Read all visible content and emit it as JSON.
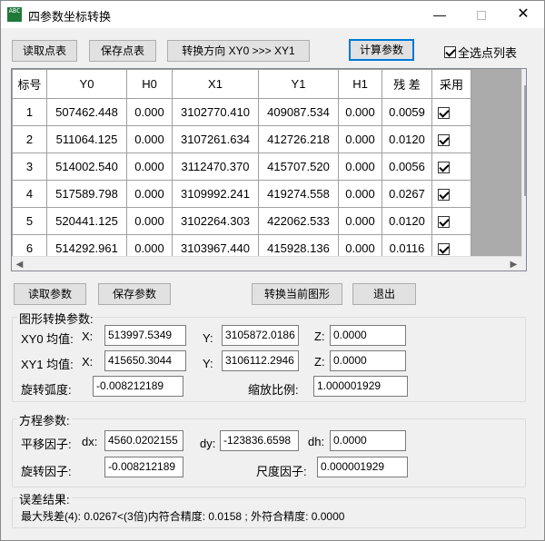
{
  "window": {
    "title": "四参数坐标转换",
    "icon_glyph": "ABC",
    "minimize": "—",
    "close": "✕"
  },
  "toolbar": {
    "read_points": "读取点表",
    "save_points": "保存点表",
    "direction": "转换方向 XY0 >>> XY1",
    "calc_params": "计算参数",
    "select_all_label": "全选点列表",
    "select_all_checked": true
  },
  "table": {
    "headers": [
      "标号",
      "Y0",
      "H0",
      "X1",
      "Y1",
      "H1",
      "残 差",
      "采用"
    ],
    "rows": [
      {
        "id": "1",
        "y0": "507462.448",
        "h0": "0.000",
        "x1": "3102770.410",
        "y1": "409087.534",
        "h1": "0.000",
        "res": "0.0059",
        "used": true
      },
      {
        "id": "2",
        "y0": "511064.125",
        "h0": "0.000",
        "x1": "3107261.634",
        "y1": "412726.218",
        "h1": "0.000",
        "res": "0.0120",
        "used": true
      },
      {
        "id": "3",
        "y0": "514002.540",
        "h0": "0.000",
        "x1": "3112470.370",
        "y1": "415707.520",
        "h1": "0.000",
        "res": "0.0056",
        "used": true
      },
      {
        "id": "4",
        "y0": "517589.798",
        "h0": "0.000",
        "x1": "3109992.241",
        "y1": "419274.558",
        "h1": "0.000",
        "res": "0.0267",
        "used": true
      },
      {
        "id": "5",
        "y0": "520441.125",
        "h0": "0.000",
        "x1": "3102264.303",
        "y1": "422062.533",
        "h1": "0.000",
        "res": "0.0120",
        "used": true
      },
      {
        "id": "6",
        "y0": "514292.961",
        "h0": "0.000",
        "x1": "3103967.440",
        "y1": "415928.136",
        "h1": "0.000",
        "res": "0.0116",
        "used": true
      }
    ]
  },
  "actions": {
    "read_params": "读取参数",
    "save_params": "保存参数",
    "convert_shape": "转换当前图形",
    "exit": "退出"
  },
  "transform_params": {
    "group_title": "图形转换参数:",
    "xy0_label": "XY0 均值:",
    "xy1_label": "XY1 均值:",
    "x_label": "X:",
    "y_label": "Y:",
    "z_label": "Z:",
    "xy0_x": "513997.5349",
    "xy0_y": "3105872.0186",
    "xy0_z": "0.0000",
    "xy1_x": "415650.3044",
    "xy1_y": "3106112.2946",
    "xy1_z": "0.0000",
    "rotation_label": "旋转弧度:",
    "rotation": "-0.008212189",
    "scale_label": "缩放比例:",
    "scale": "1.000001929"
  },
  "equation_params": {
    "group_title": "方程参数:",
    "translation_label": "平移因子:",
    "dx_label": "dx:",
    "dx": "4560.0202155",
    "dy_label": "dy:",
    "dy": "-123836.6598",
    "dh_label": "dh:",
    "dh": "0.0000",
    "rotation_label": "旋转因子:",
    "rotation": "-0.008212189",
    "scale_label": "尺度因子:",
    "scale": "0.000001929"
  },
  "error_result": {
    "group_title": "误差结果:",
    "summary": "最大残差(4): 0.0267<(3倍)内符合精度: 0.0158 ; 外符合精度: 0.0000"
  }
}
